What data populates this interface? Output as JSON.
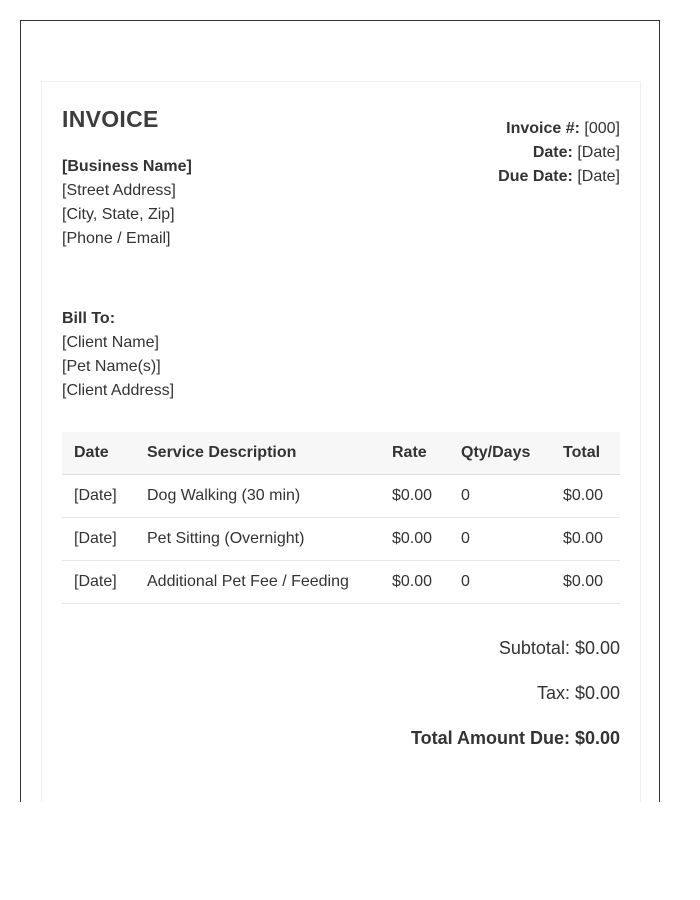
{
  "invoice": {
    "title": "INVOICE",
    "business": {
      "name": "[Business Name]",
      "street": "[Street Address]",
      "city": "[City, State, Zip]",
      "contact": "[Phone / Email]"
    },
    "meta": {
      "number_label": "Invoice #:",
      "number_value": "[000]",
      "date_label": "Date:",
      "date_value": "[Date]",
      "due_label": "Due Date:",
      "due_value": "[Date]"
    },
    "bill_to": {
      "label": "Bill To:",
      "client_name": "[Client Name]",
      "pet_names": "[Pet Name(s)]",
      "client_address": "[Client Address]"
    },
    "table": {
      "headers": [
        "Date",
        "Service Description",
        "Rate",
        "Qty/Days",
        "Total"
      ],
      "rows": [
        [
          "[Date]",
          "Dog Walking (30 min)",
          "$0.00",
          "0",
          "$0.00"
        ],
        [
          "[Date]",
          "Pet Sitting (Overnight)",
          "$0.00",
          "0",
          "$0.00"
        ],
        [
          "[Date]",
          "Additional Pet Fee / Feeding",
          "$0.00",
          "0",
          "$0.00"
        ]
      ]
    },
    "totals": {
      "subtotal": "Subtotal: $0.00",
      "tax": "Tax: $0.00",
      "total_due": "Total Amount Due: $0.00"
    }
  }
}
